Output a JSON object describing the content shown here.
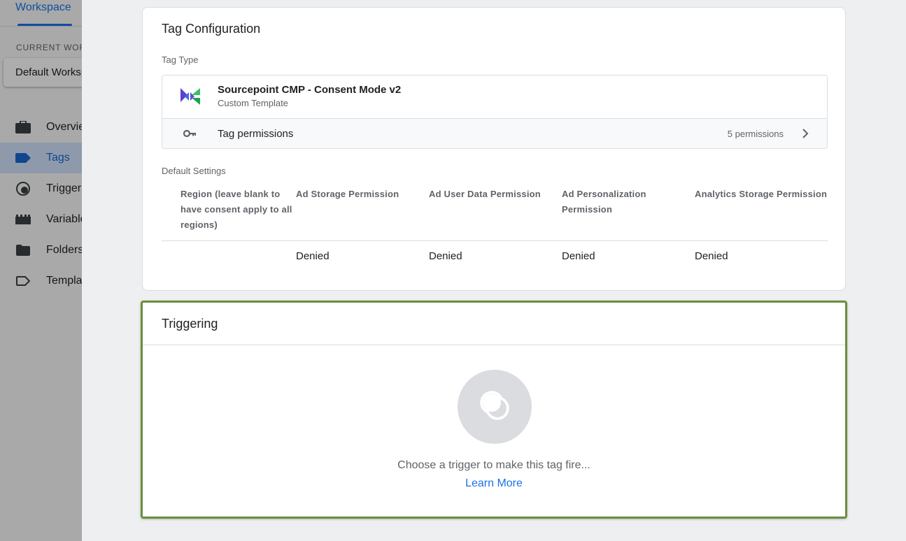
{
  "background_app": {
    "workspace_tab": "Workspace",
    "current_workspace_label": "CURRENT WORKSPACE",
    "current_workspace_value": "Default Workspace",
    "nav_items": [
      {
        "label": "Overview",
        "icon": "briefcase-icon",
        "active": false
      },
      {
        "label": "Tags",
        "icon": "tag-icon",
        "active": true
      },
      {
        "label": "Triggers",
        "icon": "trigger-icon",
        "active": false
      },
      {
        "label": "Variables",
        "icon": "variables-icon",
        "active": false
      },
      {
        "label": "Folders",
        "icon": "folder-icon",
        "active": false
      },
      {
        "label": "Templates",
        "icon": "template-icon",
        "active": false
      }
    ]
  },
  "tag_configuration": {
    "title": "Tag Configuration",
    "tag_type_label": "Tag Type",
    "tag_type": {
      "name": "Sourcepoint CMP - Consent Mode v2",
      "subtitle": "Custom Template",
      "logo_icon": "sourcepoint-logo-icon"
    },
    "permissions": {
      "label": "Tag permissions",
      "count": "5 permissions"
    },
    "default_settings_label": "Default Settings",
    "table": {
      "headers": [
        "Region (leave blank to have consent apply to all regions)",
        "Ad Storage Permission",
        "Ad User Data Permission",
        "Ad Personalization Permission",
        "Analytics Storage Permission"
      ],
      "rows": [
        [
          "",
          "Denied",
          "Denied",
          "Denied",
          "Denied"
        ]
      ]
    }
  },
  "triggering": {
    "title": "Triggering",
    "hint": "Choose a trigger to make this tag fire...",
    "learn_more": "Learn More",
    "highlight_color": "#6b8e3b"
  },
  "colors": {
    "accent": "#1a73e8",
    "active_nav_bg": "#d2e3fc"
  }
}
